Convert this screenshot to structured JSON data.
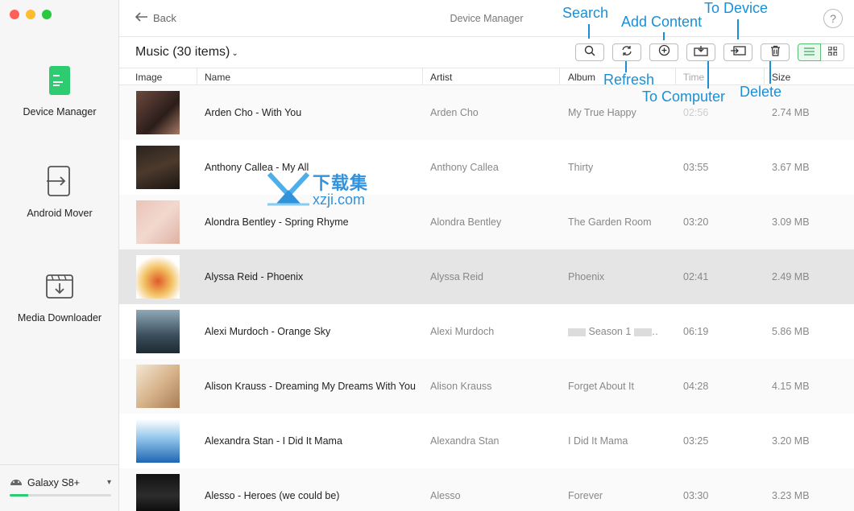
{
  "window": {
    "title": "Device Manager"
  },
  "header": {
    "back_label": "Back",
    "title": "Device Manager",
    "help_label": "?"
  },
  "sidebar": {
    "items": [
      {
        "label": "Device Manager"
      },
      {
        "label": "Android Mover"
      },
      {
        "label": "Media Downloader"
      }
    ],
    "device": {
      "name": "Galaxy S8+",
      "storage_used_fraction": 0.18
    }
  },
  "toolbar": {
    "section_title": "Music (30 items)",
    "caret": "⌄"
  },
  "table": {
    "columns": [
      "Image",
      "Name",
      "Artist",
      "Album",
      "Time",
      "Size"
    ],
    "rows": [
      {
        "name": "Arden Cho - With You",
        "artist": "Arden Cho",
        "album": "My True Happy",
        "time": "02:56",
        "size": "2.74 MB"
      },
      {
        "name": "Anthony Callea - My All",
        "artist": "Anthony Callea",
        "album": "Thirty",
        "time": "03:55",
        "size": "3.67 MB"
      },
      {
        "name": "Alondra Bentley - Spring Rhyme",
        "artist": "Alondra Bentley",
        "album": "The Garden Room",
        "time": "03:20",
        "size": "3.09 MB"
      },
      {
        "name": "Alyssa Reid - Phoenix",
        "artist": "Alyssa Reid",
        "album": "Phoenix",
        "time": "02:41",
        "size": "2.49 MB"
      },
      {
        "name": "Alexi Murdoch - Orange Sky",
        "artist": "Alexi Murdoch",
        "album": "Season 1",
        "time": "06:19",
        "size": "5.86 MB"
      },
      {
        "name": "Alison Krauss - Dreaming My Dreams With You",
        "artist": "Alison Krauss",
        "album": "Forget About It",
        "time": "04:28",
        "size": "4.15 MB"
      },
      {
        "name": "Alexandra Stan - I Did It Mama",
        "artist": "Alexandra Stan",
        "album": "I Did It Mama",
        "time": "03:25",
        "size": "3.20 MB"
      },
      {
        "name": "Alesso - Heroes (we could be)",
        "artist": "Alesso",
        "album": "Forever",
        "time": "03:30",
        "size": "3.23 MB"
      }
    ]
  },
  "callouts": {
    "search": "Search",
    "add_content": "Add Content",
    "to_device": "To Device",
    "refresh": "Refresh",
    "to_computer": "To Computer",
    "delete": "Delete"
  },
  "watermark": {
    "cn": "下载集",
    "url": "xzji.com"
  },
  "colors": {
    "callout": "#1a8fd6",
    "accent_green": "#2ecc71",
    "selected_row": "#e5e5e5"
  }
}
